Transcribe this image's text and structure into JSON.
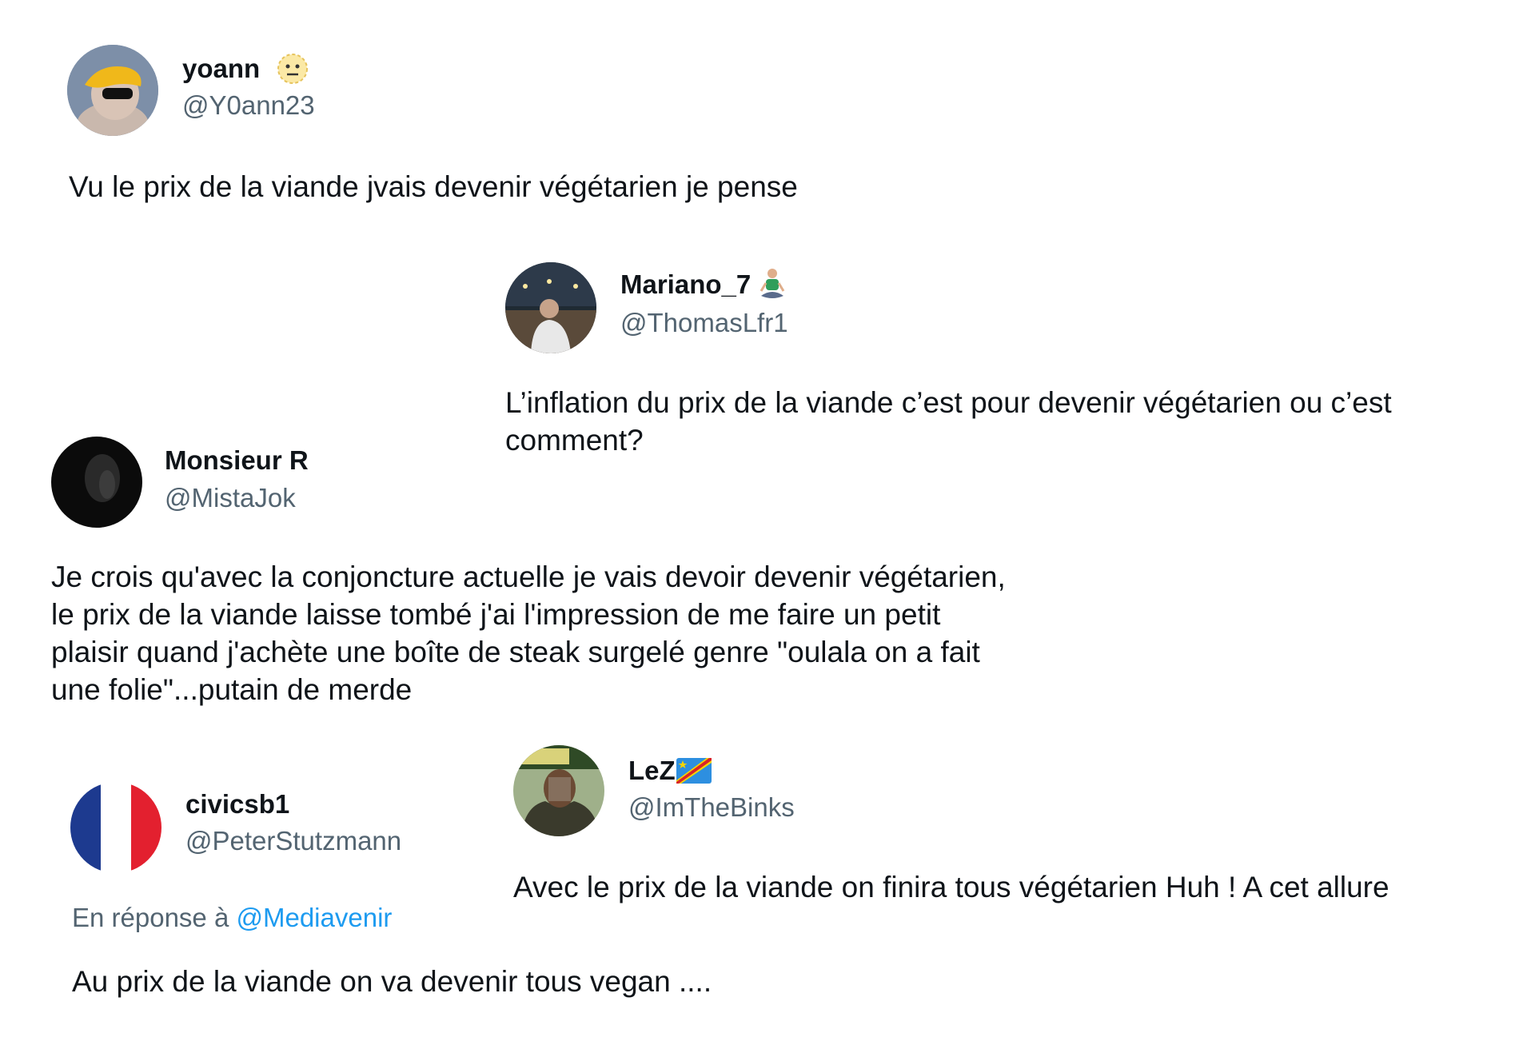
{
  "tweets": [
    {
      "name": "yoann",
      "name_emoji": "neutral-face-icon",
      "handle": "@Y0ann23",
      "text": "Vu le prix de la viande jvais devenir végétarien je pense"
    },
    {
      "name": "Mariano_7",
      "name_emoji": "person-in-lotus-position-icon",
      "handle": "@ThomasLfr1",
      "text": "L’inflation du prix de la viande c’est pour devenir végétarien ou c’est comment?"
    },
    {
      "name": "Monsieur R",
      "handle": "@MistaJok",
      "text_lines": [
        "Je crois qu'avec la conjoncture actuelle je vais devoir devenir végétarien,",
        "le prix de la viande laisse tombé j'ai l'impression de me faire un petit",
        "plaisir quand j'achète une boîte de steak surgelé genre \"oulala on a fait",
        "une folie\"...putain de merde"
      ]
    },
    {
      "name": "civicsb1",
      "handle": "@PeterStutzmann",
      "reply_prefix": "En réponse à",
      "reply_mention": "@Mediavenir",
      "text": "Au prix de la viande on va devenir tous vegan ...."
    },
    {
      "name": "LeZ",
      "name_emoji": "flag-dr-congo-icon",
      "handle": "@ImTheBinks",
      "text": "Avec le prix de la viande on finira tous végétarien Huh ! A cet allure"
    }
  ],
  "colors": {
    "text": "#0f1419",
    "secondary": "#536471",
    "link": "#1d9bf0",
    "background": "#ffffff"
  }
}
